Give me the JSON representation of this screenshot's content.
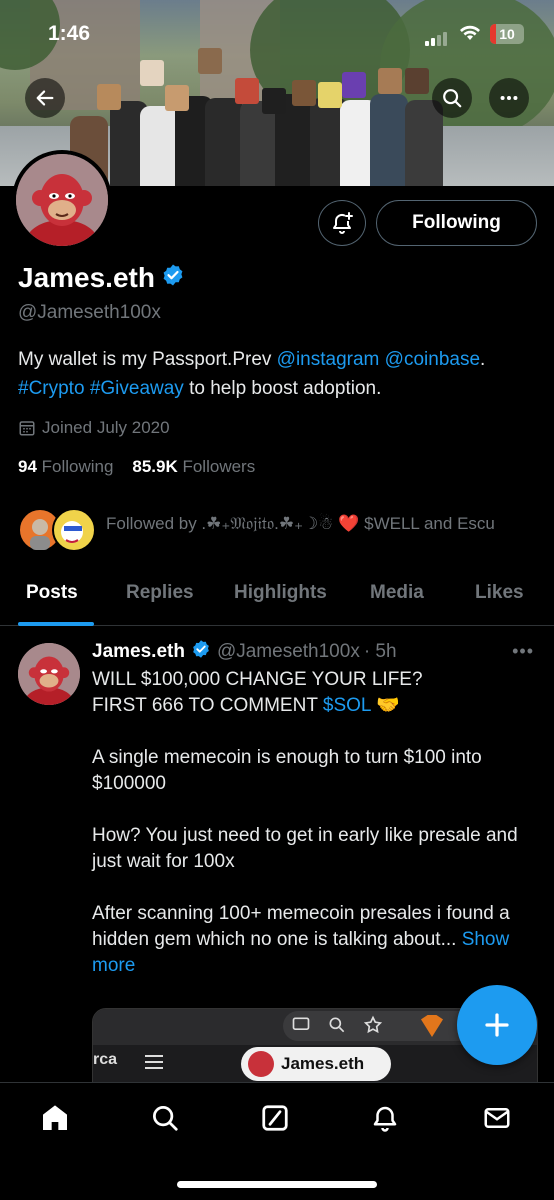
{
  "status_bar": {
    "time": "1:46",
    "battery": "10"
  },
  "profile": {
    "name": "James.eth",
    "handle": "@Jameseth100x",
    "bio": {
      "text1": "My wallet is my Passport.Prev ",
      "mention1": "@instagram",
      "space1": " ",
      "mention2": "@coinbase",
      "text2": ".",
      "hashtag1": "#Crypto",
      "space2": " ",
      "hashtag2": "#Giveaway",
      "text3": " to help boost adoption."
    },
    "joined": "Joined July 2020",
    "following_count": "94",
    "following_label": " Following",
    "followers_count": "85.9K",
    "followers_label": " Followers",
    "followed_by": "Followed by .☘₊𝔐𝔬𝔧𝔦𝔱𝔬.☘₊☽☃ ❤️ $WELL and Escu",
    "following_button": "Following"
  },
  "tabs": [
    {
      "label": "Posts",
      "active": true
    },
    {
      "label": "Replies",
      "active": false
    },
    {
      "label": "Highlights",
      "active": false
    },
    {
      "label": "Media",
      "active": false
    },
    {
      "label": "Likes",
      "active": false
    }
  ],
  "post": {
    "author_name": "James.eth",
    "author_handle": "@Jameseth100x",
    "time": "· 5h",
    "line1": "WILL $100,000 CHANGE YOUR LIFE?",
    "line2a": "FIRST 666 TO COMMENT ",
    "line2_link": "$SOL",
    "line2_emoji": " 🤝",
    "para2": "A single memecoin is enough to turn $100 into $100000",
    "para3": "How? You just need to get in early like presale and just wait for 100x",
    "para4": "After scanning 100+ memecoin presales i found a hidden gem which no one is talking about... ",
    "show_more": "Show more",
    "media_chip_text": "James.eth",
    "media_left_text": "rca"
  },
  "colors": {
    "accent": "#1d9bf0",
    "background": "#000000",
    "muted": "#71767b"
  },
  "icons": {
    "back": "arrow-left-icon",
    "search": "search-icon",
    "more": "more-horizontal-icon",
    "bell": "bell-plus-icon",
    "verified": "verified-badge-icon",
    "calendar": "calendar-icon",
    "compose": "plus-icon",
    "nav": [
      "home-icon",
      "search-icon",
      "grok-icon",
      "notifications-icon",
      "messages-icon"
    ]
  }
}
